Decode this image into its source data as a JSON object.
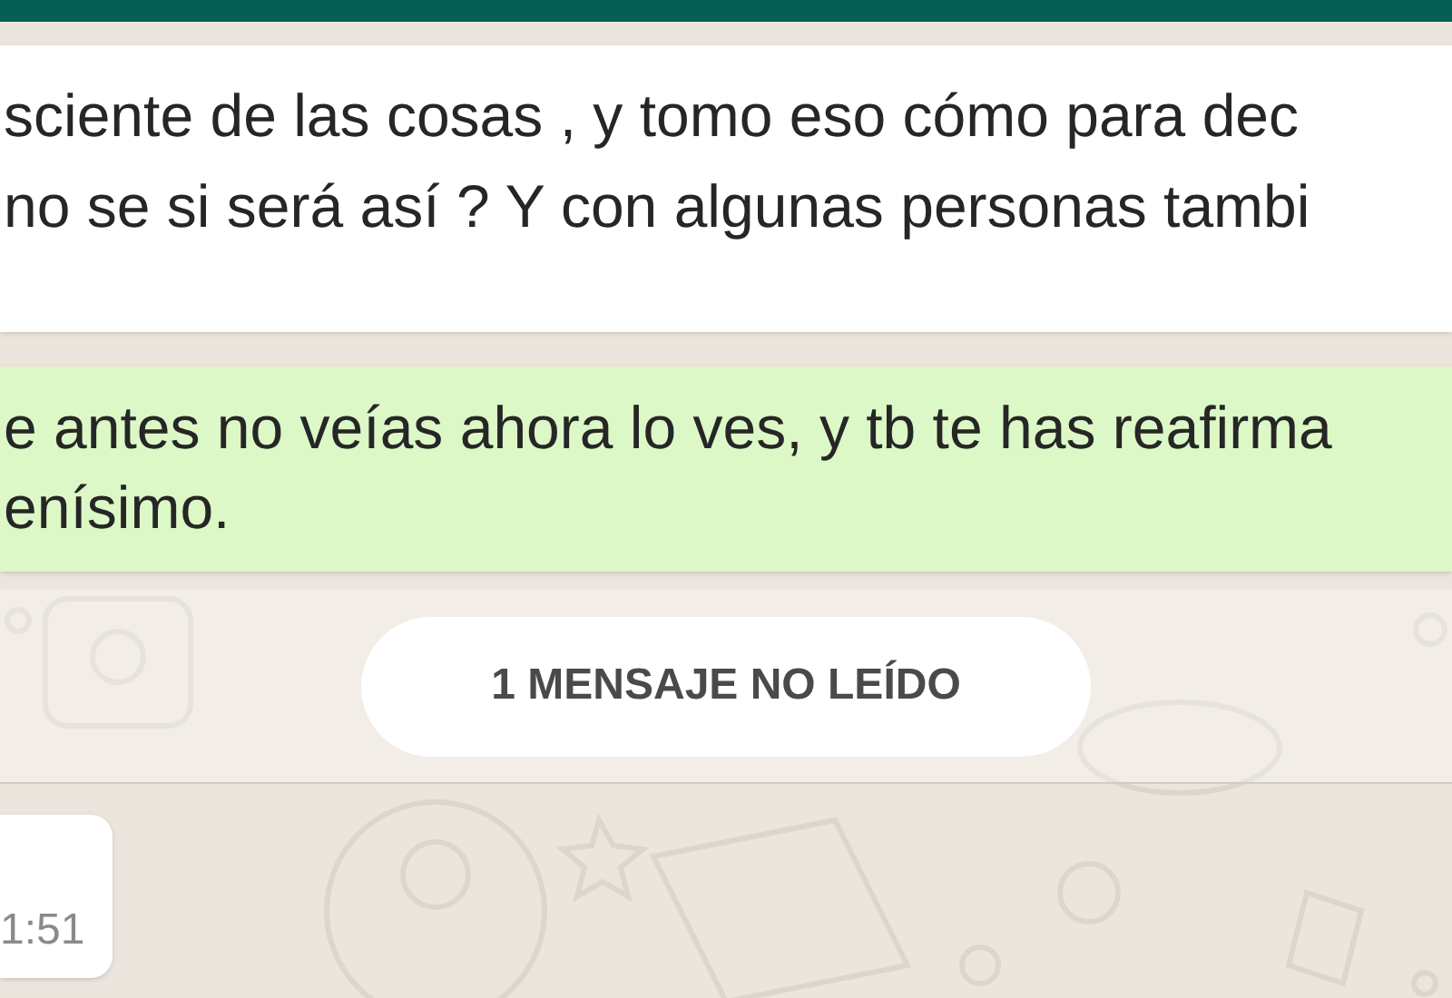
{
  "messages": [
    {
      "kind": "incoming",
      "lines": [
        "sciente de las cosas , y tomo eso cómo para dec",
        "no se si será así ? Y con algunas personas tambi"
      ]
    },
    {
      "kind": "outgoing",
      "lines": [
        "e antes no veías ahora lo ves, y tb te has reafirma",
        "enísimo."
      ]
    },
    {
      "kind": "unread",
      "lines": [
        "1 MENSAJE NO LEÍDO"
      ]
    },
    {
      "kind": "incoming_time",
      "lines": [
        "1:51"
      ]
    }
  ]
}
